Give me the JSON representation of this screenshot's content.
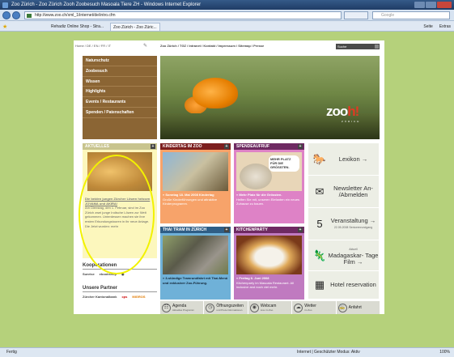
{
  "window": {
    "title": "Zoo Zürich - Zoo Zürich Zooh Zoobesuch Masoala Tiere ZH - Windows Internet Explorer"
  },
  "addressbar": {
    "url": "http://www.zoo.ch/xml_1/internet/de/intro.cfm",
    "search_placeholder": "Google"
  },
  "tabs": {
    "favorite": "Rehadiz Online Shop - Stra...",
    "active": "Zoo Zürich - Zoo Züric...",
    "tools": [
      "Seite",
      "Extras"
    ]
  },
  "page": {
    "lang_links": "Home / DE / EN / FR / IT",
    "top_links": "Zoo Zürich / TGZ / Intranet / Kontakt / Impressum / Sitemap / Presse",
    "search_label": "Suche",
    "menu": [
      "Naturschutz",
      "Zoobesuch",
      "Wissen",
      "Highlights",
      "Events / Restaurants",
      "Spenden / Patenschaften"
    ],
    "logo": {
      "text": "zoo",
      "accent": "h!",
      "sub": "ZÜRICH"
    },
    "aktuelles": {
      "title": "AKTUELLES",
      "lead": "Die beiden jungen Zürcher Löwen heissen JOVAMA und AKIRA!",
      "body": "Am Dienstag, den 1. Februar, sind im Zoo Zürich zwei junge Indische Löwen zur Welt gekommen. Unterdessen machen sie ihre ersten Erkundungstouren in ihr neue Anlage. Die Jetzt wurden: mehr"
    },
    "kindertag": {
      "title": "KINDERTAG IM ZOO",
      "lead": "» Sonntag 18. Mai 2008 Kindertag",
      "body": "Große Kinderführungen und attraktive Kinderprogramm."
    },
    "spende": {
      "title": "SPENDEAUFRUF",
      "bubble": "MEHR PLATZ FÜR DIE GRÖSSTEN.",
      "lead": "» Mehr Platz für die Grössten.",
      "body": "Helfen Sie mit, unseren Elefanten ein neues Zuhause zu bauen."
    },
    "thai": {
      "title": "THAI TRAM IN ZÜRICH",
      "lead": "» 3-stündige Tramrundfahrt mit Thai-Menü und exklusiver Zoo-Führung."
    },
    "kitchen": {
      "title": "KITCHENPARTY",
      "lead": "» Freitag 6. Juni 2008",
      "body": "Kitchenparty im Masoala Restaurant. All inclusive and noch viel mehr."
    },
    "right": [
      {
        "label": "Lexikon →",
        "sub": "",
        "icon": "🐎"
      },
      {
        "label": "Newsletter An- /Abmelden",
        "sub": "",
        "icon": "✉"
      },
      {
        "label": "Veranstaltung →",
        "sub": "22.05.2008 Seniorenrundgang",
        "icon": "5"
      },
      {
        "label": "Madagaskar- Tage Film →",
        "sub": "Aktuell",
        "icon": "🦎"
      },
      {
        "label": "Hotel reservation",
        "sub": "",
        "icon": "▦"
      }
    ],
    "kooperationen": {
      "title": "Kooperationen",
      "logos": [
        "Sunrise",
        "ebookshop",
        "◉"
      ]
    },
    "partner": {
      "title": "Unsere Partner",
      "logos": [
        "Zürcher Kantonalbank",
        "cps",
        "MIGROS"
      ]
    },
    "bottom": [
      {
        "label": "Agenda",
        "sub": "Aktuelles Programm",
        "icon": "☷"
      },
      {
        "label": "Öffnungszeiten",
        "sub": "und Preis-Informationen",
        "icon": "◷"
      },
      {
        "label": "Webcam",
        "sub": "Live im Zoo",
        "icon": "◉"
      },
      {
        "label": "Wetter",
        "sub": "im Zoo",
        "icon": "☁"
      },
      {
        "label": "Anfahrt",
        "sub": "",
        "icon": "🚋"
      }
    ]
  },
  "status": {
    "left": "Fertig",
    "mid": "Internet | Geschützter Modus: Aktiv",
    "zoom": "100%"
  }
}
